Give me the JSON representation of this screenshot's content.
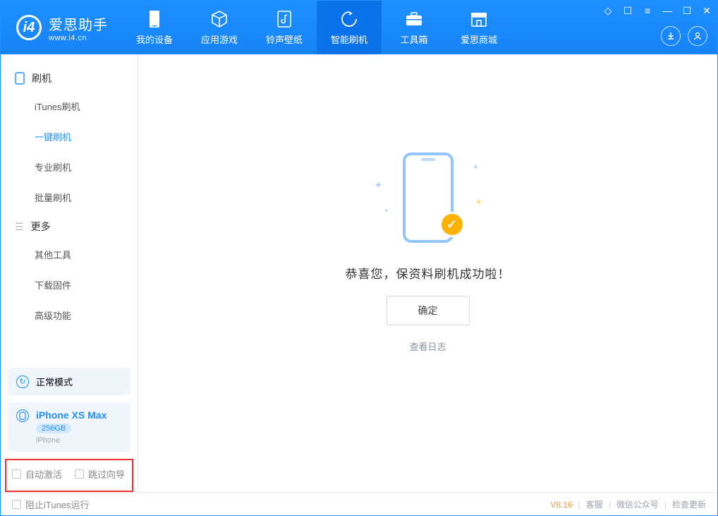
{
  "app": {
    "title": "爱思助手",
    "subtitle": "www.i4.cn"
  },
  "nav": {
    "items": [
      {
        "label": "我的设备"
      },
      {
        "label": "应用游戏"
      },
      {
        "label": "铃声壁纸"
      },
      {
        "label": "智能刷机"
      },
      {
        "label": "工具箱"
      },
      {
        "label": "爱思商城"
      }
    ]
  },
  "sidebar": {
    "group_flash": "刷机",
    "items_flash": [
      {
        "label": "iTunes刷机"
      },
      {
        "label": "一键刷机"
      },
      {
        "label": "专业刷机"
      },
      {
        "label": "批量刷机"
      }
    ],
    "group_more": "更多",
    "items_more": [
      {
        "label": "其他工具"
      },
      {
        "label": "下载固件"
      },
      {
        "label": "高级功能"
      }
    ]
  },
  "mode_card": {
    "label": "正常模式"
  },
  "device": {
    "name": "iPhone XS Max",
    "storage": "256GB",
    "type": "iPhone"
  },
  "options": {
    "auto_activate": "自动激活",
    "skip_guide": "跳过向导"
  },
  "main": {
    "message": "恭喜您，保资料刷机成功啦！",
    "ok": "确定",
    "view_log": "查看日志"
  },
  "footer": {
    "block_itunes": "阻止iTunes运行",
    "version": "V8.16",
    "links": [
      "客服",
      "微信公众号",
      "检查更新"
    ]
  }
}
